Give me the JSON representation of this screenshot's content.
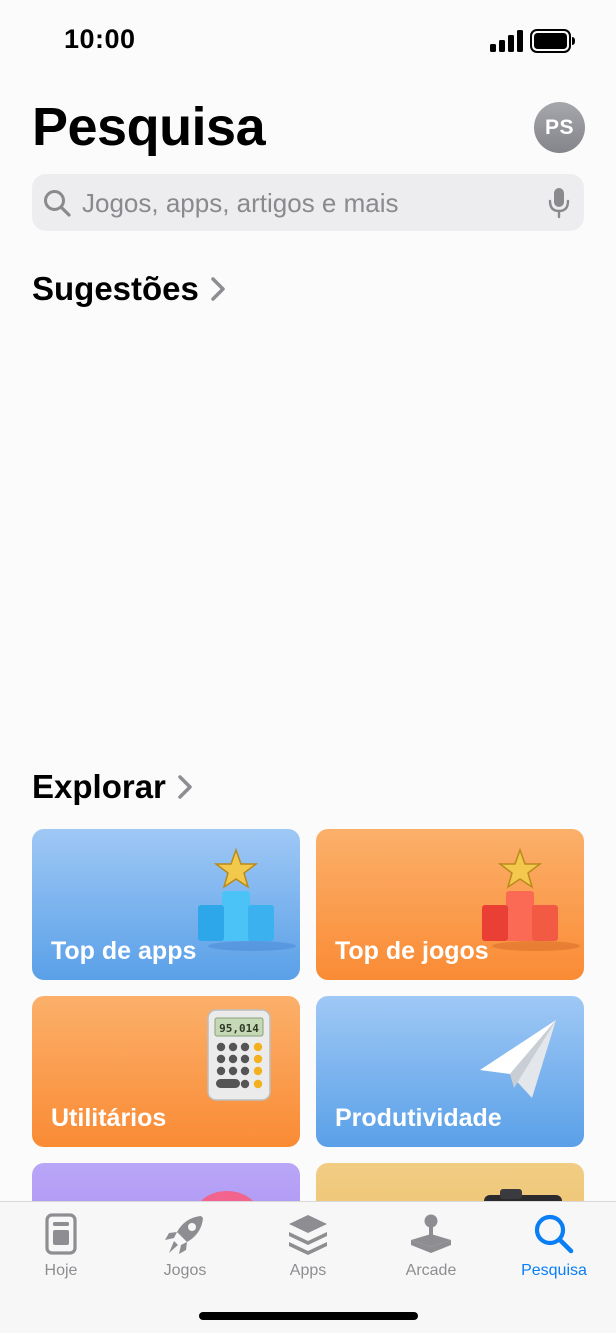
{
  "status_bar": {
    "time": "10:00"
  },
  "header": {
    "title": "Pesquisa",
    "avatar_initials": "PS"
  },
  "search": {
    "placeholder": "Jogos, apps, artigos e mais"
  },
  "sections": {
    "suggestions_title": "Sugestões",
    "explore_title": "Explorar"
  },
  "categories": [
    {
      "label": "Top de apps",
      "icon": "podium-blue-icon"
    },
    {
      "label": "Top de jogos",
      "icon": "podium-red-icon"
    },
    {
      "label": "Utilitários",
      "icon": "calculator-icon",
      "display": "95,014"
    },
    {
      "label": "Produtividade",
      "icon": "paper-plane-icon"
    },
    {
      "label": "",
      "icon": "balloon-icon"
    },
    {
      "label": "",
      "icon": "camera-icon"
    }
  ],
  "tabs": [
    {
      "label": "Hoje",
      "icon": "today-icon"
    },
    {
      "label": "Jogos",
      "icon": "rocket-icon"
    },
    {
      "label": "Apps",
      "icon": "layers-icon"
    },
    {
      "label": "Arcade",
      "icon": "joystick-icon"
    },
    {
      "label": "Pesquisa",
      "icon": "search-icon",
      "active": true
    }
  ],
  "colors": {
    "accent": "#0a7ef5",
    "inactive": "#8e8e92"
  }
}
